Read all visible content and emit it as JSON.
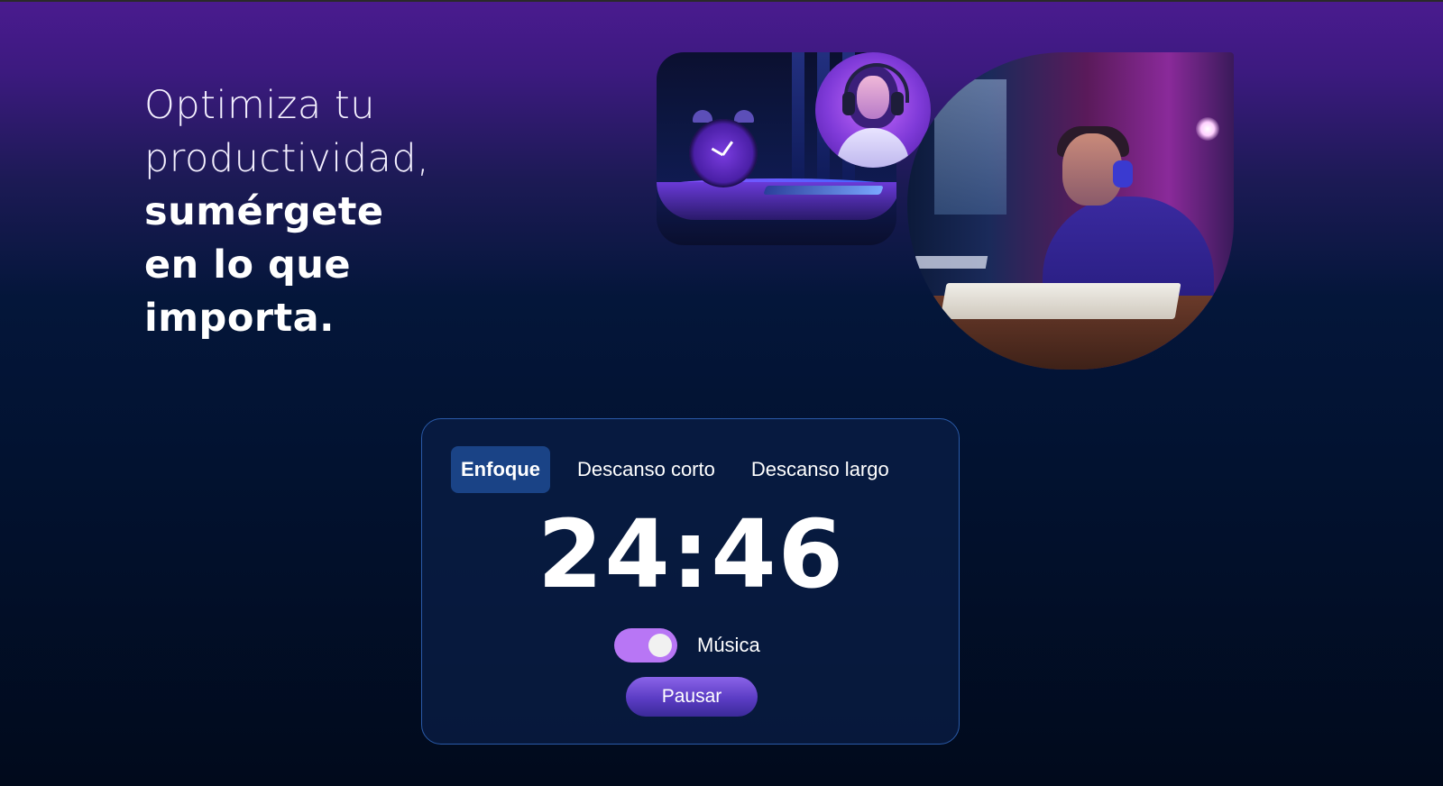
{
  "hero": {
    "line1": "Optimiza tu",
    "line2": "productividad,",
    "line3": "sumérgete",
    "line4": "en lo que",
    "line5": "importa."
  },
  "timer": {
    "tabs": [
      {
        "label": "Enfoque",
        "active": true
      },
      {
        "label": "Descanso corto",
        "active": false
      },
      {
        "label": "Descanso largo",
        "active": false
      }
    ],
    "time": "24:46",
    "music": {
      "label": "Música",
      "enabled": true
    },
    "pause_label": "Pausar"
  },
  "colors": {
    "accent": "#b876f5",
    "active_tab": "#1a4386",
    "card_border": "#2a5aa8"
  },
  "images": [
    "alarm-clock-illustration",
    "woman-with-headphones",
    "student-studying-with-headphones"
  ]
}
